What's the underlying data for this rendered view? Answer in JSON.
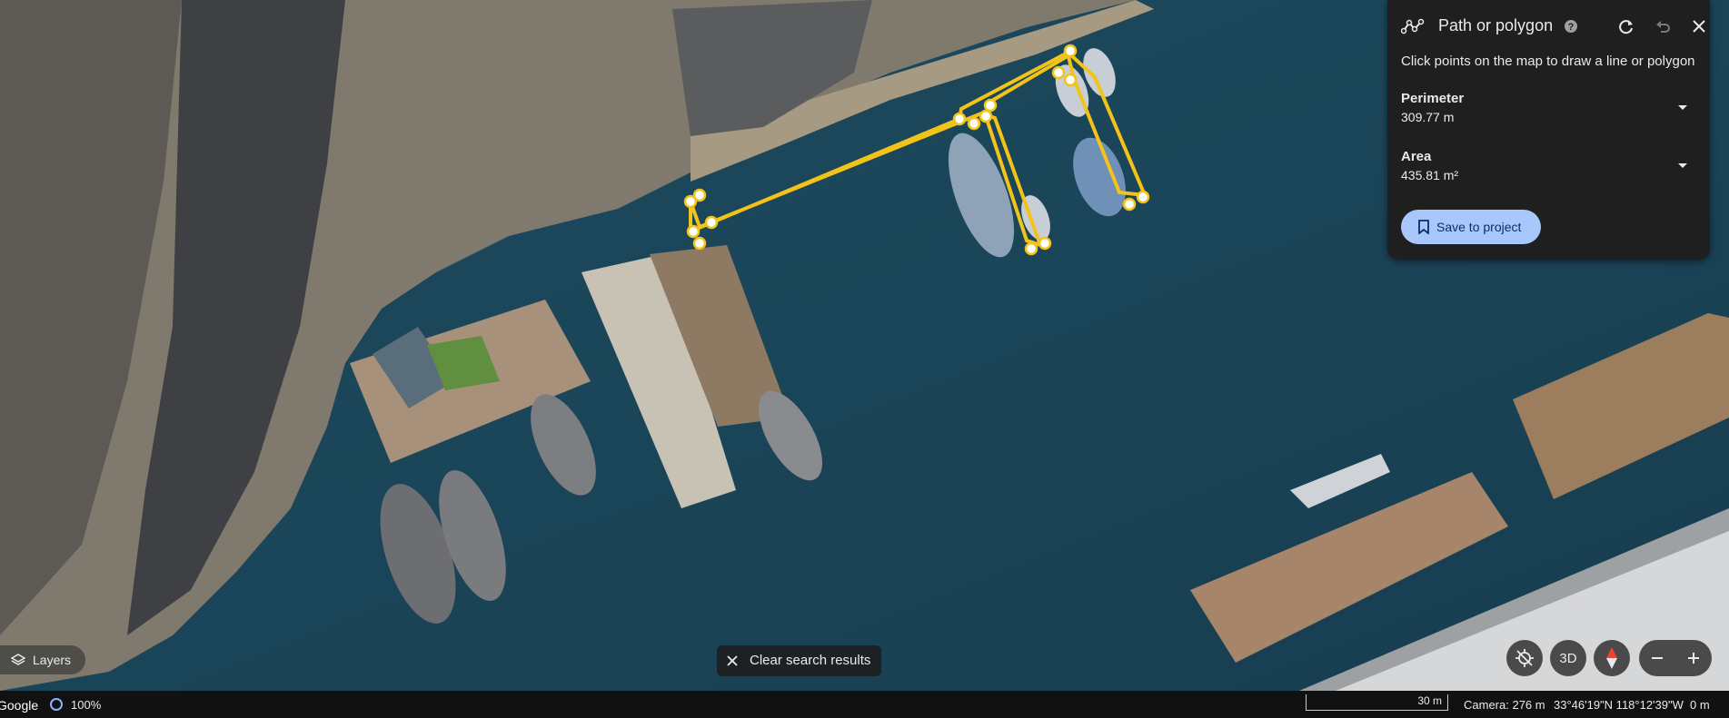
{
  "panel": {
    "title": "Path or polygon",
    "instruction": "Click points on the map to draw a line or polygon",
    "perimeter_label": "Perimeter",
    "perimeter_value": "309.77 m",
    "area_label": "Area",
    "area_value": "435.81 m²",
    "save_label": "Save to project"
  },
  "map_controls": {
    "layers_label": "Layers",
    "clear_label": "Clear search results",
    "threed_label": "3D"
  },
  "status_bar": {
    "logo": "Google",
    "load_percent": "100%",
    "scale_label": "30 m",
    "camera": "Camera: 276 m",
    "coordinates": "33°46'19\"N 118°12'39\"W",
    "elevation": "0 m"
  },
  "colors": {
    "water": "#1b4558",
    "path_accent": "#f2c318",
    "panel_bg": "#1f1f1f",
    "save_button": "#a8c7fa"
  }
}
